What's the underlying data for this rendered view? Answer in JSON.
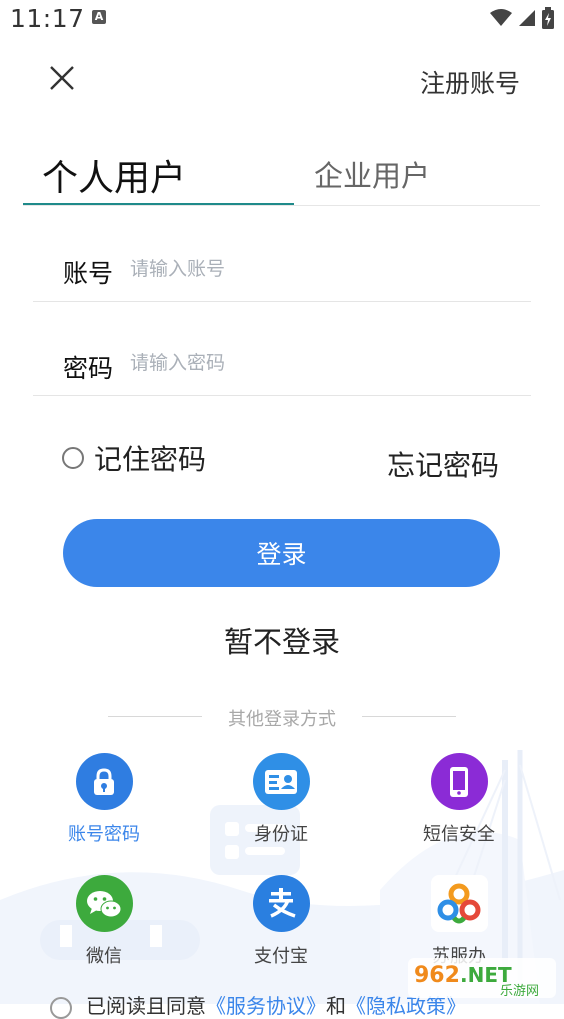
{
  "status_bar": {
    "time": "11:17",
    "notification_icon": "A",
    "icons": [
      "wifi-icon",
      "signal-icon",
      "battery-icon"
    ]
  },
  "header": {
    "close_icon": "close-icon",
    "register_label": "注册账号"
  },
  "tabs": [
    {
      "label": "个人用户",
      "active": true
    },
    {
      "label": "企业用户",
      "active": false
    }
  ],
  "form": {
    "account_label": "账号",
    "account_placeholder": "请输入账号",
    "account_value": "",
    "password_label": "密码",
    "password_placeholder": "请输入密码",
    "password_value": "",
    "remember_label": "记住密码",
    "remember_checked": false,
    "forgot_label": "忘记密码",
    "login_label": "登录",
    "skip_label": "暂不登录"
  },
  "other_login": {
    "title": "其他登录方式",
    "methods": [
      {
        "label": "账号密码",
        "icon": "lock-icon",
        "color": "#2f7de1",
        "active": true
      },
      {
        "label": "身份证",
        "icon": "id-card-icon",
        "color": "#2f8fe6",
        "active": false
      },
      {
        "label": "短信安全",
        "icon": "phone-icon",
        "color": "#8b2bd6",
        "active": false
      },
      {
        "label": "微信",
        "icon": "wechat-icon",
        "color": "#3daa3d",
        "active": false
      },
      {
        "label": "支付宝",
        "icon": "alipay-icon",
        "color": "#2a7fe0",
        "active": false
      },
      {
        "label": "苏服办",
        "icon": "sufuban-icon",
        "color": "#ffffff",
        "active": false
      }
    ]
  },
  "agreement": {
    "prefix": "已阅读且同意",
    "service_link": "《服务协议》",
    "connector": "和",
    "privacy_link": "《隐私政策》"
  },
  "watermark": {
    "text": "962.NET",
    "sub": "乐游网"
  },
  "colors": {
    "accent": "#3b86ea",
    "tab_underline": "#1f8a8a"
  }
}
